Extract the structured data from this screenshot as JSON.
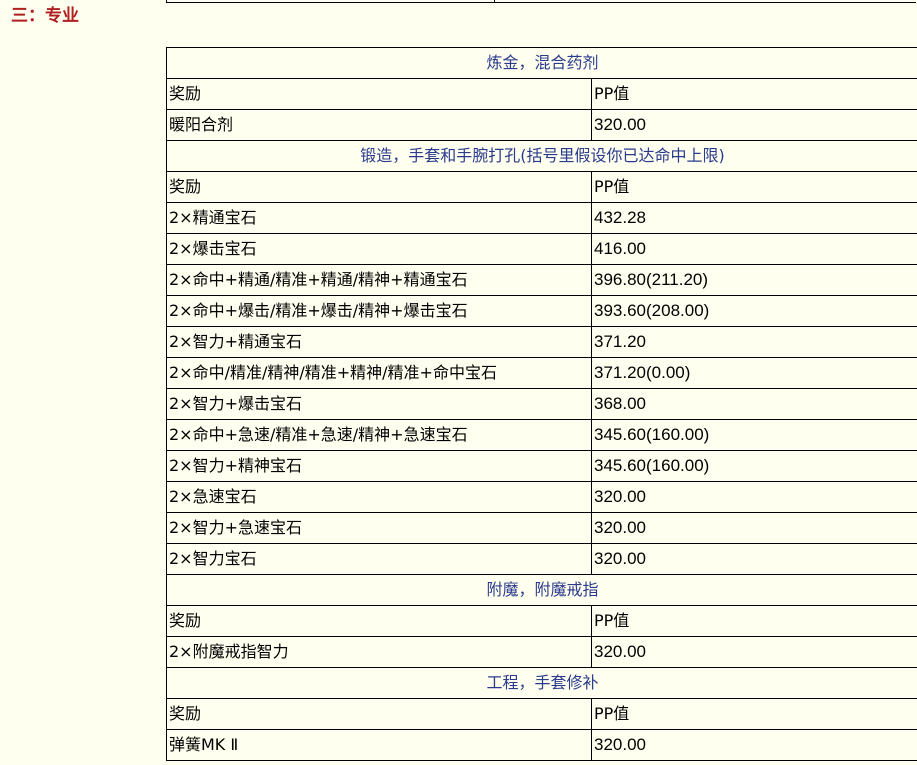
{
  "heading": "三：专业",
  "groups": [
    {
      "title": "炼金，混合药剂",
      "header": [
        "奖励",
        "PP值"
      ],
      "rows": [
        [
          "暖阳合剂",
          "320.00"
        ]
      ]
    },
    {
      "title": "锻造，手套和手腕打孔(括号里假设你已达命中上限)",
      "header": [
        "奖励",
        "PP值"
      ],
      "rows": [
        [
          "2×精通宝石",
          "432.28"
        ],
        [
          "2×爆击宝石",
          "416.00"
        ],
        [
          "2×命中+精通/精准+精通/精神+精通宝石",
          "396.80(211.20)"
        ],
        [
          "2×命中+爆击/精准+爆击/精神+爆击宝石",
          "393.60(208.00)"
        ],
        [
          "2×智力+精通宝石",
          "371.20"
        ],
        [
          "2×命中/精准/精神/精准+精神/精准+命中宝石",
          "371.20(0.00)"
        ],
        [
          "2×智力+爆击宝石",
          "368.00"
        ],
        [
          "2×命中+急速/精准+急速/精神+急速宝石",
          "345.60(160.00)"
        ],
        [
          "2×智力+精神宝石",
          "345.60(160.00)"
        ],
        [
          "2×急速宝石",
          "320.00"
        ],
        [
          "2×智力+急速宝石",
          "320.00"
        ],
        [
          "2×智力宝石",
          "320.00"
        ]
      ]
    },
    {
      "title": "附魔，附魔戒指",
      "header": [
        "奖励",
        "PP值"
      ],
      "rows": [
        [
          "2×附魔戒指智力",
          "320.00"
        ]
      ]
    },
    {
      "title": "工程，手套修补",
      "header": [
        "奖励",
        "PP值"
      ],
      "rows": [
        [
          "弹簧MK Ⅱ",
          "320.00"
        ]
      ]
    }
  ]
}
